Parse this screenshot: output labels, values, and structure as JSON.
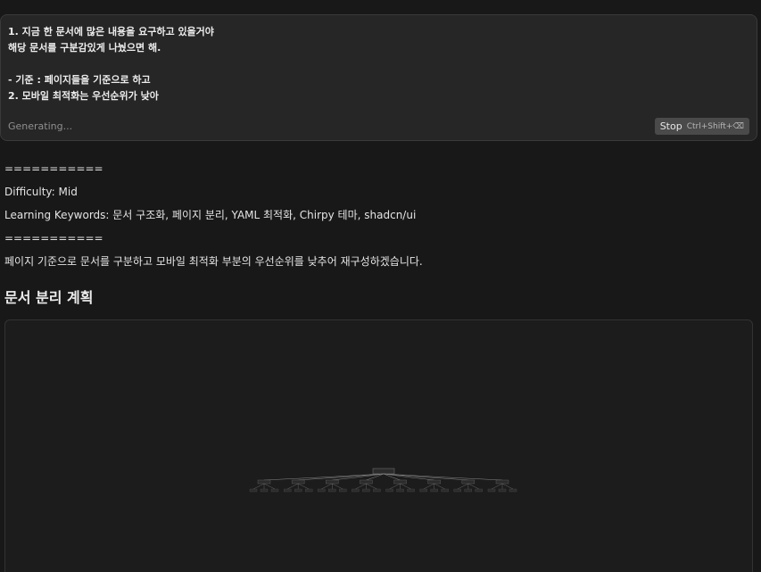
{
  "prompt": {
    "lines": [
      "1. 지금 한 문서에 많은 내용을 요구하고 있을거야",
      "해당 문서를 구분감있게 나눴으면 해.",
      "",
      "- 기준 : 페이지들을 기준으로 하고",
      "2. 모바일 최적화는 우선순위가 낮아"
    ],
    "status": "Generating...",
    "stop_label": "Stop",
    "stop_shortcut": "Ctrl+Shift+⌫"
  },
  "response": {
    "separator_top": "===========",
    "difficulty": "Difficulty: Mid",
    "keywords": "Learning Keywords: 문서 구조화, 페이지 분리, YAML 최적화, Chirpy 테마, shadcn/ui",
    "separator_bottom": "===========",
    "summary": "페이지 기준으로 문서를 구분하고 모바일 최적화 부분의 우선순위를 낮추어 재구성하겠습니다.",
    "heading": "문서 분리 계획"
  },
  "diagram": {
    "branches": 8,
    "leaves_per_branch": 3
  },
  "colors": {
    "background": "#181818",
    "panel": "#262626",
    "border": "#3a3a3a",
    "stop_button": "#4a4a4a"
  }
}
